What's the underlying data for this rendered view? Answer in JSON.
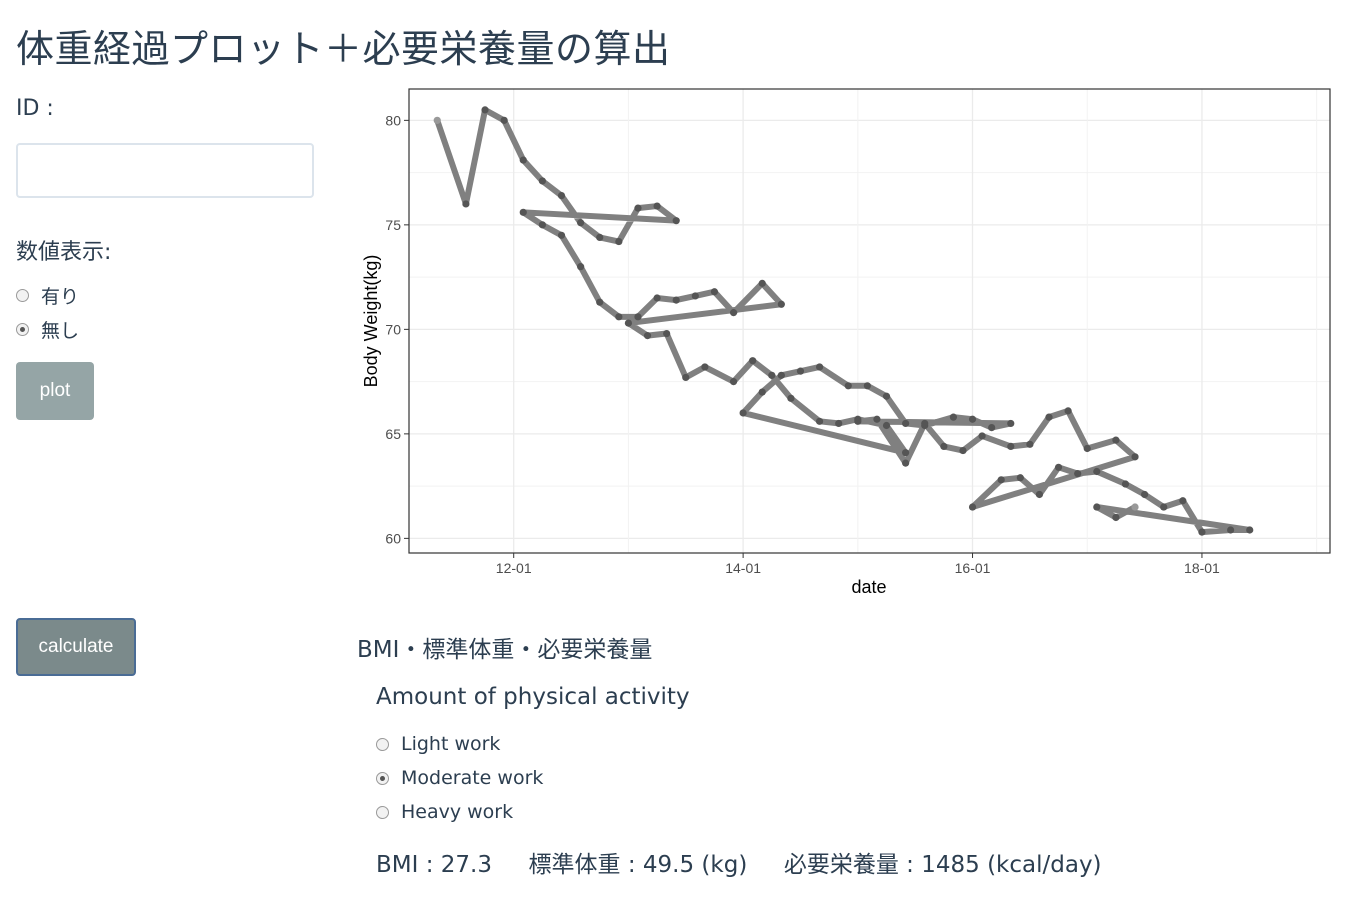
{
  "page": {
    "title": "体重経過プロット＋必要栄養量の算出"
  },
  "sidebar": {
    "id_label": "ID :",
    "id_value": "",
    "display_label": "数値表示:",
    "display_options": [
      "有り",
      "無し"
    ],
    "display_selected": "無し",
    "plot_button": "plot",
    "calculate_button": "calculate"
  },
  "results": {
    "section_title": "BMI・標準体重・必要栄養量",
    "activity_title": "Amount of physical activity",
    "activity_options": [
      "Light work",
      "Moderate work",
      "Heavy work"
    ],
    "activity_selected": "Moderate work",
    "summary": "BMI : 27.3     標準体重 : 49.5 (kg)     必要栄養量 : 1485 (kcal/day)"
  },
  "chart_data": {
    "type": "line",
    "title": "",
    "xlabel": "date",
    "ylabel": "Body Weight(kg)",
    "x_ticks": [
      "12-01",
      "14-01",
      "16-01",
      "18-01"
    ],
    "y_ticks": [
      60,
      65,
      70,
      75,
      80
    ],
    "ylim": [
      59.3,
      81.5
    ],
    "grid": true,
    "line_color": "#808080",
    "point_color": "#555555",
    "x": [
      "11-05",
      "11-08",
      "11-10",
      "11-12",
      "11-14",
      "11-16",
      "11-18",
      "11-20",
      "11-22",
      "11-24",
      "11-26",
      "11-28",
      "11-30",
      "12-02",
      "12-04",
      "12-06",
      "12-08",
      "12-10",
      "12-12",
      "12-14",
      "12-16",
      "12-18",
      "12-20",
      "12-22",
      "12-24",
      "12-27",
      "12-29",
      "13-01",
      "13-03",
      "13-05",
      "13-07",
      "13-09",
      "13-12",
      "13-14",
      "13-16",
      "13-18",
      "13-21",
      "13-23",
      "13-25",
      "13-28",
      "13-30",
      "14-01",
      "14-03",
      "14-05",
      "14-07",
      "14-09",
      "14-12",
      "14-14",
      "14-16",
      "14-18",
      "14-20",
      "14-23",
      "14-25",
      "14-27",
      "14-29",
      "15-01",
      "15-03",
      "15-06",
      "15-08",
      "15-10",
      "15-12",
      "15-14",
      "15-17",
      "15-19",
      "15-21",
      "15-23",
      "15-25",
      "15-28",
      "15-30",
      "16-01",
      "16-04",
      "16-06",
      "16-08",
      "16-10",
      "16-12",
      "16-14",
      "16-17",
      "16-19",
      "16-21",
      "16-23",
      "16-25",
      "16-28",
      "16-30",
      "17-02",
      "17-04",
      "17-06",
      "17-08",
      "17-11",
      "17-13",
      "17-15",
      "17-17",
      "17-19",
      "17-22",
      "17-24",
      "17-26",
      "17-28",
      "18-01",
      "18-03",
      "18-05",
      "18-07",
      "18-09",
      "18-12",
      "18-14",
      "18-16",
      "18-18",
      "18-20",
      "18-23",
      "18-25",
      "18-27",
      "18-29",
      "19-01"
    ],
    "series": [
      {
        "values": [
          80.0,
          76.0,
          80.5,
          80.0,
          78.1,
          77.1,
          76.4,
          75.1,
          74.4,
          74.2,
          75.8,
          75.9,
          75.2,
          75.6,
          75.0,
          74.5,
          73.0,
          71.3,
          70.6,
          70.6,
          71.5,
          71.4,
          71.6,
          71.8,
          70.8,
          72.2,
          71.2,
          70.3,
          69.7,
          69.8,
          67.7,
          68.2,
          67.5,
          68.5,
          67.8,
          66.7,
          65.6,
          65.5,
          65.7,
          65.4,
          64.1,
          66.0,
          67.0,
          67.8,
          68.0,
          68.2,
          67.3,
          67.3,
          66.8,
          65.5,
          65.4,
          65.8,
          65.7,
          65.3,
          65.5,
          65.6,
          65.7,
          63.6,
          65.5,
          64.4,
          64.2,
          64.9,
          64.4,
          64.5,
          65.8,
          66.1,
          64.3,
          64.7,
          63.9,
          61.5,
          62.8,
          62.9,
          62.1,
          63.4,
          63.1,
          63.2,
          62.6,
          62.1,
          61.5,
          61.8,
          60.3,
          60.4,
          60.4,
          61.5,
          61.0,
          61.5
        ]
      }
    ]
  }
}
